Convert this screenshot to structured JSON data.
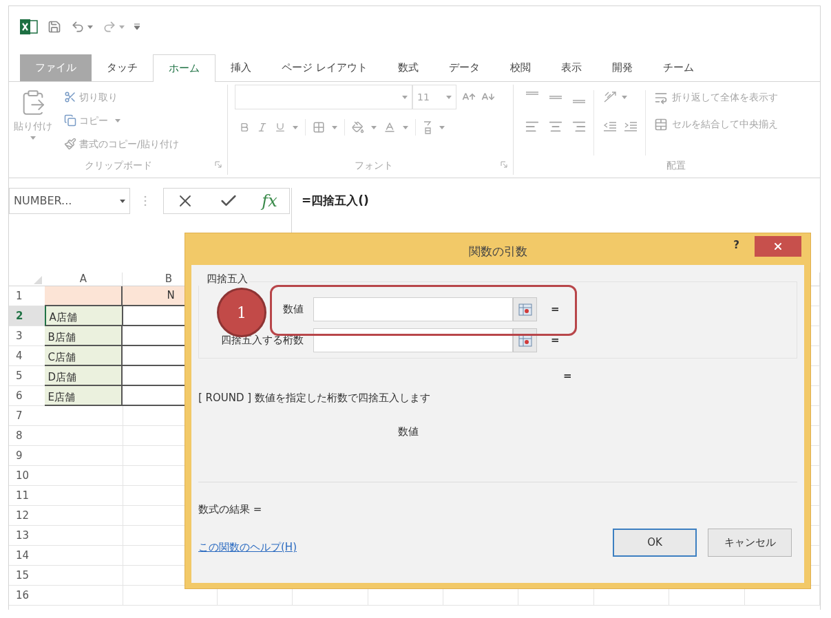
{
  "tabs": [
    {
      "label": "ファイル",
      "kind": "file",
      "selected": false
    },
    {
      "label": "タッチ",
      "kind": "tab",
      "selected": false
    },
    {
      "label": "ホーム",
      "kind": "tab",
      "selected": true
    },
    {
      "label": "挿入",
      "kind": "tab",
      "selected": false
    },
    {
      "label": "ページ レイアウト",
      "kind": "tab",
      "selected": false
    },
    {
      "label": "数式",
      "kind": "tab",
      "selected": false
    },
    {
      "label": "データ",
      "kind": "tab",
      "selected": false
    },
    {
      "label": "校閲",
      "kind": "tab",
      "selected": false
    },
    {
      "label": "表示",
      "kind": "tab",
      "selected": false
    },
    {
      "label": "開発",
      "kind": "tab",
      "selected": false
    },
    {
      "label": "チーム",
      "kind": "tab",
      "selected": false
    }
  ],
  "ribbon": {
    "disabled": true,
    "clipboard": {
      "paste": "貼り付け",
      "cut": "切り取り",
      "copy": "コピー",
      "format_painter": "書式のコピー/貼り付け",
      "label": "クリップボード"
    },
    "font": {
      "font_size": "11",
      "label": "フォント"
    },
    "alignment": {
      "wrap_text": "折り返して全体を表示す",
      "merge": "セルを結合して中央揃え",
      "label": "配置"
    }
  },
  "formula_bar": {
    "name_box": "NUMBER...",
    "fx": "fx",
    "formula": "=四捨五入()"
  },
  "grid": {
    "columns": [
      "A",
      "B"
    ],
    "rows": [
      {
        "number": "1",
        "kind": "header",
        "selected": false,
        "b": "N"
      },
      {
        "number": "2",
        "kind": "data",
        "selected": true,
        "a": "A店舗"
      },
      {
        "number": "3",
        "kind": "data",
        "selected": false,
        "a": "B店舗"
      },
      {
        "number": "4",
        "kind": "data",
        "selected": false,
        "a": "C店舗"
      },
      {
        "number": "5",
        "kind": "data",
        "selected": false,
        "a": "D店舗"
      },
      {
        "number": "6",
        "kind": "data",
        "selected": false,
        "a": "E店舗"
      },
      {
        "number": "7",
        "kind": "empty",
        "selected": false
      },
      {
        "number": "8",
        "kind": "empty",
        "selected": false
      },
      {
        "number": "9",
        "kind": "empty",
        "selected": false
      },
      {
        "number": "10",
        "kind": "empty",
        "selected": false
      },
      {
        "number": "11",
        "kind": "empty",
        "selected": false
      },
      {
        "number": "12",
        "kind": "empty",
        "selected": false
      },
      {
        "number": "13",
        "kind": "empty",
        "selected": false
      },
      {
        "number": "14",
        "kind": "empty",
        "selected": false
      },
      {
        "number": "15",
        "kind": "empty",
        "selected": false
      },
      {
        "number": "16",
        "kind": "empty",
        "selected": false
      }
    ]
  },
  "dialog": {
    "title": "関数の引数",
    "help": "?",
    "function_name": "四捨五入",
    "arguments": [
      {
        "label": "数値",
        "equals": "="
      },
      {
        "label": "四捨五入する桁数",
        "equals": "="
      }
    ],
    "result_equals": "=",
    "description": "[ ROUND ] 数値を指定した桁数で四捨五入します",
    "argument_help": "数値",
    "formula_result": "数式の結果 =",
    "help_link": "この関数のヘルプ(H)",
    "buttons": [
      {
        "label": "OK",
        "default": true
      },
      {
        "label": "キャンセル",
        "default": false
      }
    ],
    "annotation": {
      "number": "1"
    }
  }
}
